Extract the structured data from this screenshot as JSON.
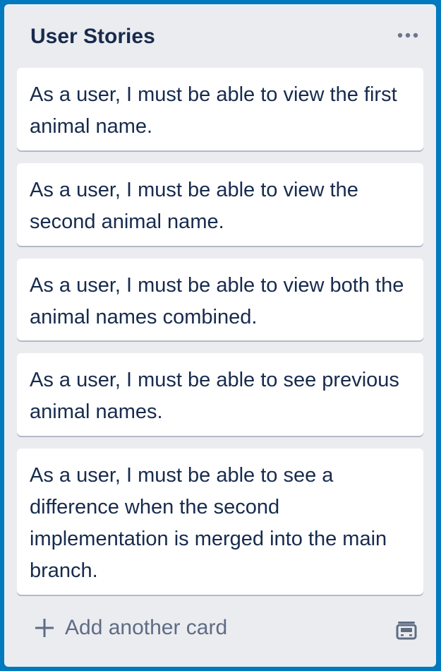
{
  "list": {
    "title": "User Stories",
    "menu_icon": "ellipsis-icon",
    "cards": [
      {
        "text": "As a user, I must be able to view the first animal name."
      },
      {
        "text": "As a user, I must be able to view the second animal name."
      },
      {
        "text": "As a user, I must be able to view both the animal names combined."
      },
      {
        "text": "As a user, I must be able to see previous animal names."
      },
      {
        "text": "As a user, I must be able to see a difference when the second implementation is merged into the main branch."
      }
    ],
    "composer": {
      "label": "Add another card",
      "icon": "plus-icon"
    },
    "template_icon": "card-template-icon"
  },
  "colors": {
    "board_background": "#0079bf",
    "list_background": "#ebecf0",
    "card_background": "#ffffff",
    "text": "#172b4d",
    "muted_text": "#5e6c84"
  }
}
